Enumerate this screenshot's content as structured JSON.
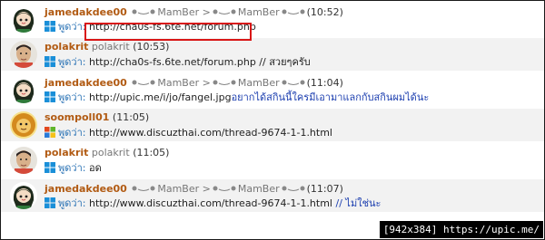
{
  "posts": [
    {
      "name": "jamedakdee00",
      "rank": "MamBer >",
      "rank2": "MamBer",
      "time": "(10:52)",
      "says": "พูดว่า:",
      "msg": "http://cha0s-fs.6te.net/forum.php",
      "msg_extra": "",
      "os": "win7",
      "avatar": "anime-girl",
      "alt": false
    },
    {
      "name": "polakrit",
      "rank": "polakrit",
      "rank2": "",
      "time": "(10:53)",
      "says": "พูดว่า:",
      "msg": "http://cha0s-fs.6te.net/forum.php // สวยๆครับ",
      "msg_extra": "",
      "os": "win7",
      "avatar": "boy-photo",
      "alt": true
    },
    {
      "name": "jamedakdee00",
      "rank": "MamBer >",
      "rank2": "MamBer",
      "time": "(11:04)",
      "says": "พูดว่า:",
      "msg": "http://upic.me/i/jo/fangel.jpg",
      "msg_extra": "อยากได้สกินนี้ใครมีเอามาแลกกับสกินผมได้นะ",
      "os": "win7",
      "avatar": "anime-girl",
      "alt": false
    },
    {
      "name": "soompoll01",
      "rank": "",
      "rank2": "",
      "time": "(11:05)",
      "says": "พูดว่า:",
      "msg": "http://www.discuzthai.com/thread-9674-1-1.html",
      "msg_extra": "",
      "os": "winxp",
      "avatar": "cartoon-lion",
      "alt": true
    },
    {
      "name": "polakrit",
      "rank": "polakrit",
      "rank2": "",
      "time": "(11:05)",
      "says": "พูดว่า:",
      "msg": "อด",
      "msg_extra": "",
      "os": "win7",
      "avatar": "boy-photo",
      "alt": false
    },
    {
      "name": "jamedakdee00",
      "rank": "MamBer >",
      "rank2": "MamBer",
      "time": "(11:07)",
      "says": "พูดว่า:",
      "msg": "http://www.discuzthai.com/thread-9674-1-1.html",
      "msg_extra": "// ไม่ใช่นะ",
      "os": "win7",
      "avatar": "anime-girl",
      "alt": true
    }
  ],
  "watermark": "[942x384] https://upic.me/",
  "highlight_color": "#d91616",
  "name_color": "#b15a12",
  "says_color": "#2b73b5"
}
